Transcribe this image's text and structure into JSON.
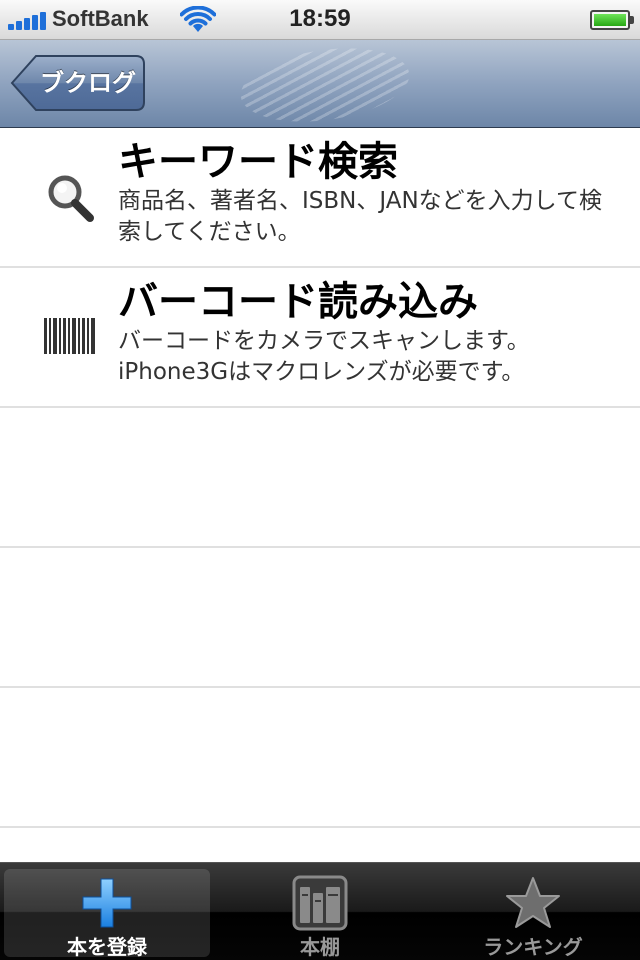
{
  "status_bar": {
    "carrier": "SoftBank",
    "time": "18:59"
  },
  "nav_bar": {
    "back_label": "ブクログ",
    "colors": {
      "bar": "#8fa3bf",
      "back_button": "#6e87ab"
    }
  },
  "list": {
    "items": [
      {
        "icon": "search-icon",
        "title": "キーワード検索",
        "description": "商品名、著者名、ISBN、JANなどを入力して検索してください。"
      },
      {
        "icon": "barcode-icon",
        "title": "バーコード読み込み",
        "description_line1": "バーコードをカメラでスキャンします。",
        "description_line2": "iPhone3Gはマクロレンズが必要です。"
      }
    ]
  },
  "tab_bar": {
    "tabs": [
      {
        "label": "本を登録",
        "icon": "plus-icon",
        "active": true
      },
      {
        "label": "本棚",
        "icon": "bookshelf-icon",
        "active": false
      },
      {
        "label": "ランキング",
        "icon": "star-icon",
        "active": false
      }
    ],
    "colors": {
      "active_icon": "#3aa2ff",
      "inactive_icon": "#8a8a8a"
    }
  }
}
